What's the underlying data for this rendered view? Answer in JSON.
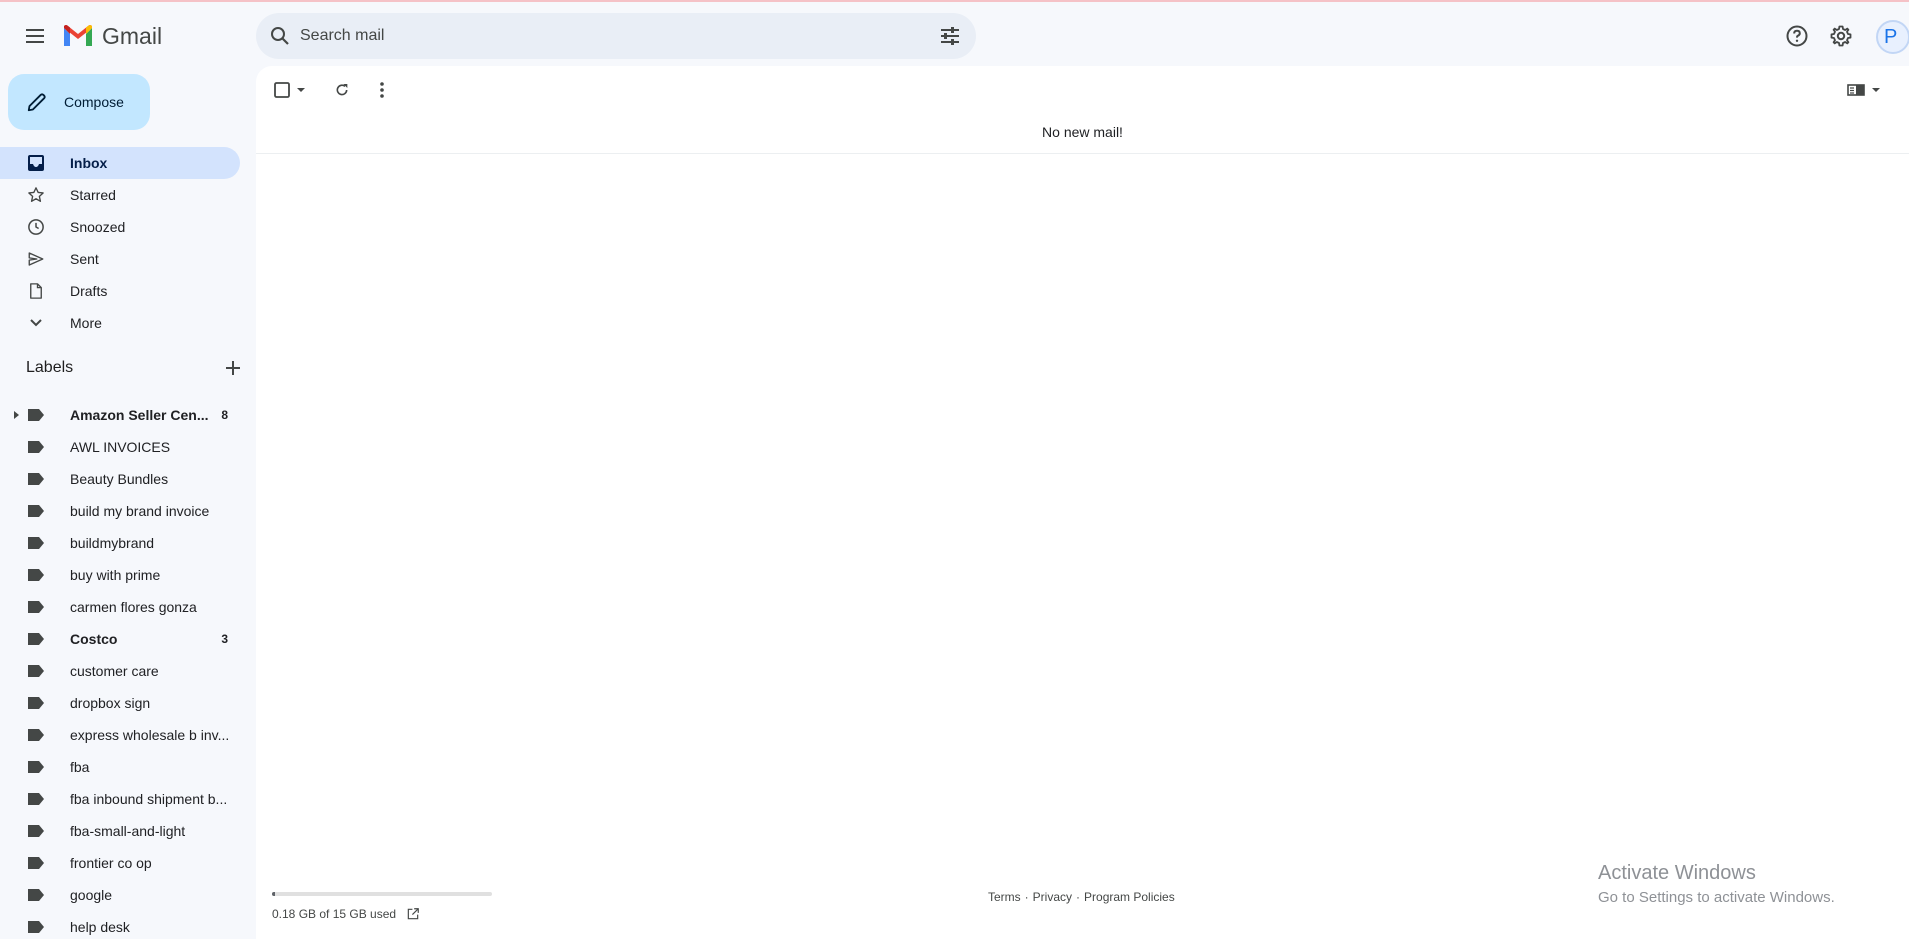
{
  "header": {
    "app_name": "Gmail",
    "search_placeholder": "Search mail",
    "avatar_letter": "P"
  },
  "sidebar": {
    "compose_label": "Compose",
    "nav": [
      {
        "label": "Inbox",
        "icon": "inbox-icon",
        "active": true
      },
      {
        "label": "Starred",
        "icon": "star-icon"
      },
      {
        "label": "Snoozed",
        "icon": "clock-icon"
      },
      {
        "label": "Sent",
        "icon": "send-icon"
      },
      {
        "label": "Drafts",
        "icon": "draft-icon"
      },
      {
        "label": "More",
        "icon": "chevron-down-icon"
      }
    ],
    "labels_title": "Labels",
    "labels": [
      {
        "label": "Amazon Seller Cen...",
        "count": "8",
        "bold": true,
        "expandable": true
      },
      {
        "label": "AWL INVOICES"
      },
      {
        "label": "Beauty Bundles"
      },
      {
        "label": "build my brand invoice"
      },
      {
        "label": "buildmybrand"
      },
      {
        "label": "buy with prime"
      },
      {
        "label": "carmen flores gonza"
      },
      {
        "label": "Costco",
        "count": "3",
        "bold": true
      },
      {
        "label": "customer care"
      },
      {
        "label": "dropbox sign"
      },
      {
        "label": "express wholesale b inv..."
      },
      {
        "label": "fba"
      },
      {
        "label": "fba inbound shipment b..."
      },
      {
        "label": "fba-small-and-light"
      },
      {
        "label": "frontier co op"
      },
      {
        "label": "google"
      },
      {
        "label": "help desk"
      }
    ]
  },
  "main": {
    "empty_message": "No new mail!",
    "storage_text": "0.18 GB of 15 GB used",
    "storage_fraction": 0.012,
    "footer": {
      "terms": "Terms",
      "sep1": "·",
      "privacy": "Privacy",
      "sep2": "·",
      "policies": "Program Policies"
    },
    "watermark": {
      "line1": "Activate Windows",
      "line2": "Go to Settings to activate Windows."
    }
  },
  "colors": {
    "background": "#f6f8fc",
    "compose": "#c2e7ff",
    "active_nav": "#d3e3fd",
    "search": "#e9eef6"
  }
}
